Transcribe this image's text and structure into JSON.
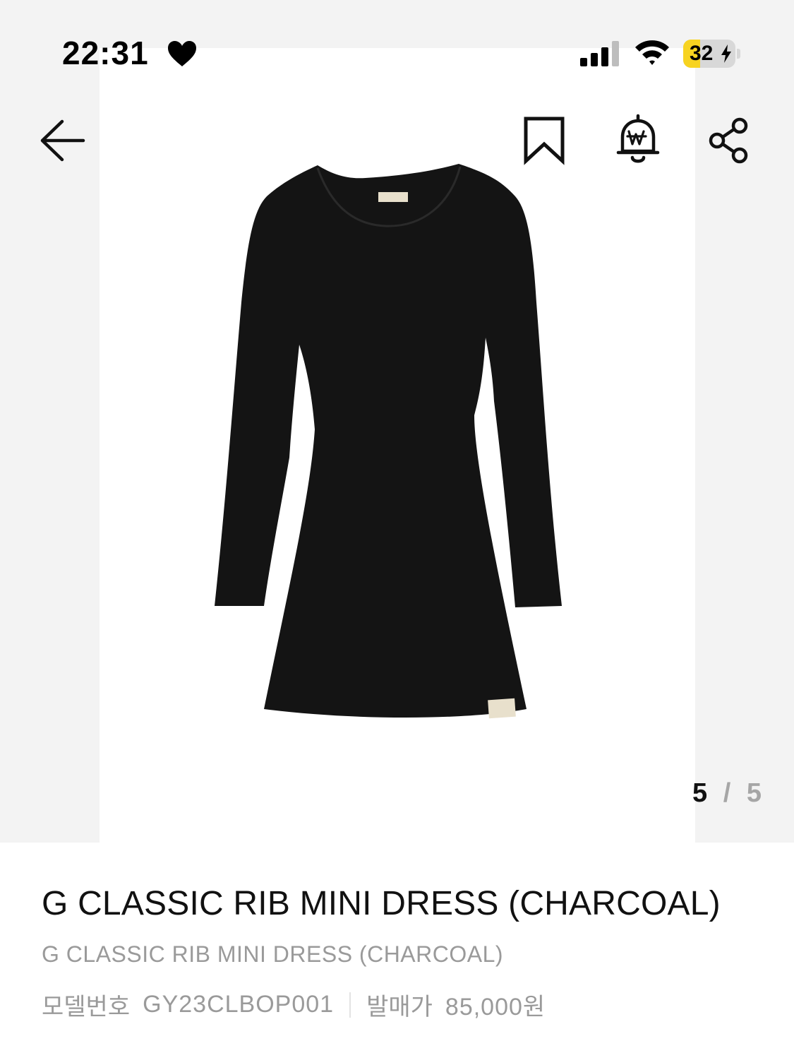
{
  "status_bar": {
    "time": "22:31",
    "battery": "32"
  },
  "gallery": {
    "current": "5",
    "separator": "/",
    "total": "5",
    "image": "charcoal-rib-mini-dress"
  },
  "nav": {
    "back_icon": "arrow-left-icon",
    "bookmark_icon": "bookmark-icon",
    "price_alert_icon": "won-bell-icon",
    "share_icon": "share-icon"
  },
  "product": {
    "title": "G CLASSIC RIB MINI DRESS (CHARCOAL)",
    "subtitle": "G CLASSIC RIB MINI DRESS (CHARCOAL)",
    "model_label": "모델번호",
    "model_number": "GY23CLBOP001",
    "release_label": "발매가",
    "release_price": "85,000원"
  },
  "colors": {
    "battery_fill": "#f7d320",
    "muted_text": "#9a9a9a",
    "gallery_bg": "#f3f3f3"
  }
}
